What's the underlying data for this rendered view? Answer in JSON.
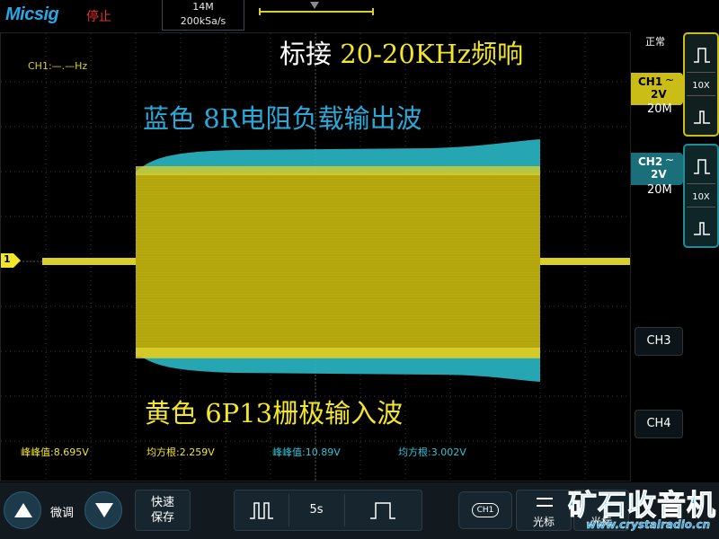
{
  "header": {
    "brand": "Micsig",
    "run_state": "停止",
    "memory_depth": "14M",
    "sample_rate": "200kSa/s"
  },
  "plot": {
    "ch1_frequency": "CH1:—.—Hz",
    "annotations": {
      "title_white": "标接",
      "title_yellow": "20-20KHz频响",
      "blue_note": "蓝色 8R电阻负载输出波",
      "yellow_note": "黄色 6P13栅极输入波"
    },
    "channel_marker": "1",
    "colors": {
      "ch1": "#d9cf2a",
      "ch2": "#2ab8c6",
      "grid": "#3a3a3a"
    },
    "measurements": [
      {
        "label": "峰峰值:8.695V",
        "channel": "ch1"
      },
      {
        "label": "均方根:2.259V",
        "channel": "ch1"
      },
      {
        "label": "峰峰值:10.89V",
        "channel": "ch2"
      },
      {
        "label": "均方根:3.002V",
        "channel": "ch2"
      }
    ]
  },
  "right_panel": {
    "mode": "正常",
    "ch1": {
      "name": "CH1",
      "coupling": "~",
      "volts": "2V",
      "bandwidth": "20M",
      "probe": "10X"
    },
    "ch2": {
      "name": "CH2",
      "coupling": "~",
      "volts": "2V",
      "bandwidth": "20M",
      "probe": "10X"
    },
    "ch3_label": "CH3",
    "ch4_label": "CH4"
  },
  "bottom_bar": {
    "fine_label": "微调",
    "save_line1": "快速",
    "save_line2": "保存",
    "timebase": "5s",
    "ch_pill": "CH1",
    "cursor_label": "光标",
    "cursor_label2": "光标"
  },
  "watermark": {
    "site_cn": "矿石收音机",
    "site_url": "www.crystalradio.cn"
  }
}
